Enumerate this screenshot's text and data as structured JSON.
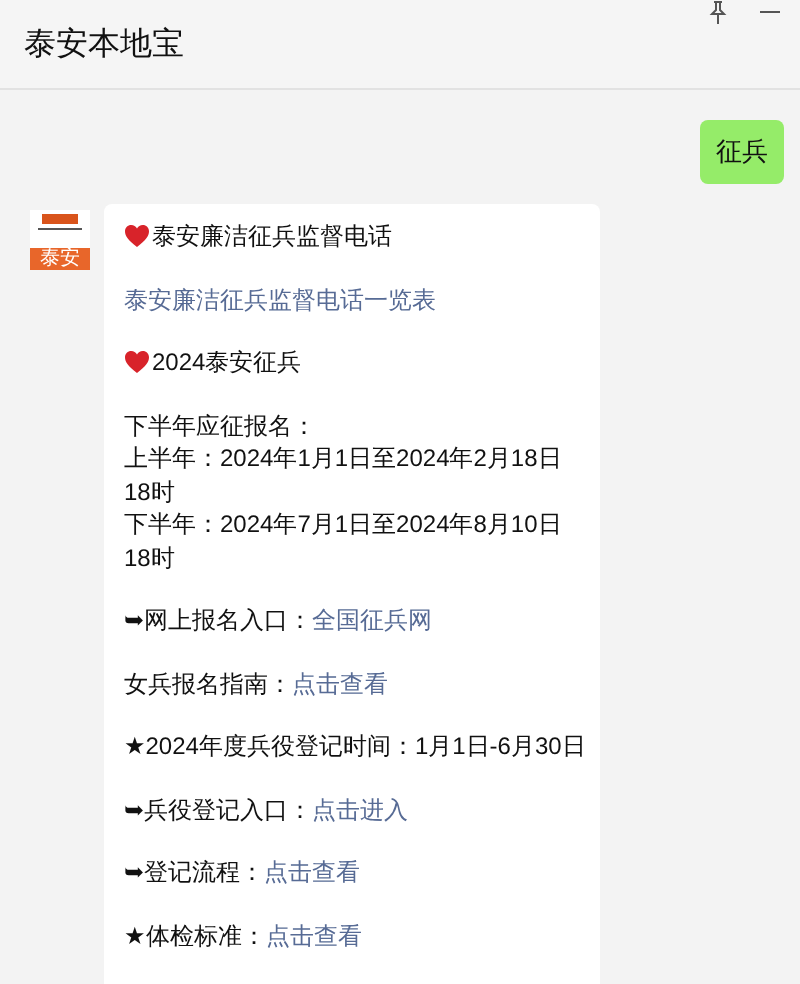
{
  "window": {
    "title": "泰安本地宝"
  },
  "messages": [
    {
      "kind": "outgoing",
      "text": "征兵"
    },
    {
      "kind": "incoming",
      "avatar_label": "泰安",
      "paragraphs": [
        {
          "lines": [
            {
              "kind": "heart",
              "text": "泰安廉洁征兵监督电话"
            }
          ]
        },
        {
          "lines": [
            {
              "link": "泰安廉洁征兵监督电话一览表"
            }
          ]
        },
        {
          "lines": [
            {
              "kind": "heart",
              "text": "2024泰安征兵"
            }
          ]
        },
        {
          "lines": [
            {
              "text": "下半年应征报名："
            },
            {
              "text": "上半年：2024年1月1日至2024年2月18日"
            },
            {
              "text": "18时"
            },
            {
              "text": "下半年：2024年7月1日至2024年8月10日"
            },
            {
              "text": "18时"
            }
          ]
        },
        {
          "lines": [
            {
              "text": "➥网上报名入口：",
              "link": "全国征兵网"
            }
          ]
        },
        {
          "lines": [
            {
              "text": "女兵报名指南：",
              "link": "点击查看"
            }
          ]
        },
        {
          "lines": [
            {
              "text": "★2024年度兵役登记时间：1月1日-6月30日"
            }
          ]
        },
        {
          "lines": [
            {
              "text": "➥兵役登记入口：",
              "link": "点击进入"
            }
          ]
        },
        {
          "lines": [
            {
              "text": "➥登记流程：",
              "link": "点击查看"
            }
          ]
        },
        {
          "lines": [
            {
              "text": "★体检标准：",
              "link": "点击查看"
            }
          ]
        }
      ]
    }
  ]
}
